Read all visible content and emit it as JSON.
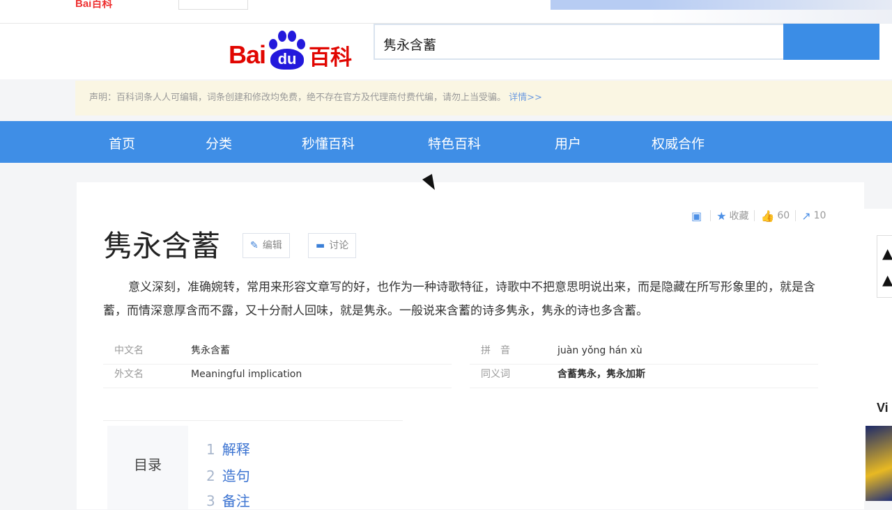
{
  "topbar": {
    "mini_logo": "Bai百科",
    "mini_search_value": ""
  },
  "header": {
    "logo_bai": "Bai",
    "logo_du": "du",
    "logo_baike": "百科",
    "search_value": "隽永含蓄"
  },
  "notice": {
    "text": "声明：百科词条人人可编辑，词条创建和修改均免费，绝不存在官方及代理商付费代编，请勿上当受骗。",
    "link": "详情>>"
  },
  "nav": [
    "首页",
    "分类",
    "秒懂百科",
    "特色百科",
    "用户",
    "权威合作"
  ],
  "actions": {
    "favorite": "收藏",
    "like_count": "60",
    "share_count": "10"
  },
  "entry": {
    "title": "隽永含蓄",
    "edit_label": "编辑",
    "discuss_label": "讨论",
    "summary": "意义深刻，准确婉转，常用来形容文章写的好，也作为一种诗歌特征，诗歌中不把意思明说出来，而是隐藏在所写形象里的，就是含蓄，而情深意厚含而不露，又十分耐人回味，就是隽永。一般说来含蓄的诗多隽永，隽永的诗也多含蓄。"
  },
  "basic_info": {
    "left": [
      {
        "name": "中文名",
        "value": "隽永含蓄"
      },
      {
        "name": "外文名",
        "value": "Meaningful implication"
      }
    ],
    "right": [
      {
        "name": "拼　音",
        "value": "juàn yǒng hán xù"
      },
      {
        "name": "同义词",
        "value": "含蓄隽永，隽永加斯"
      }
    ]
  },
  "toc": {
    "label": "目录",
    "items": [
      {
        "num": "1",
        "label": "解释"
      },
      {
        "num": "2",
        "label": "造句"
      },
      {
        "num": "3",
        "label": "备注"
      }
    ]
  },
  "side": {
    "letter": "Vi"
  }
}
